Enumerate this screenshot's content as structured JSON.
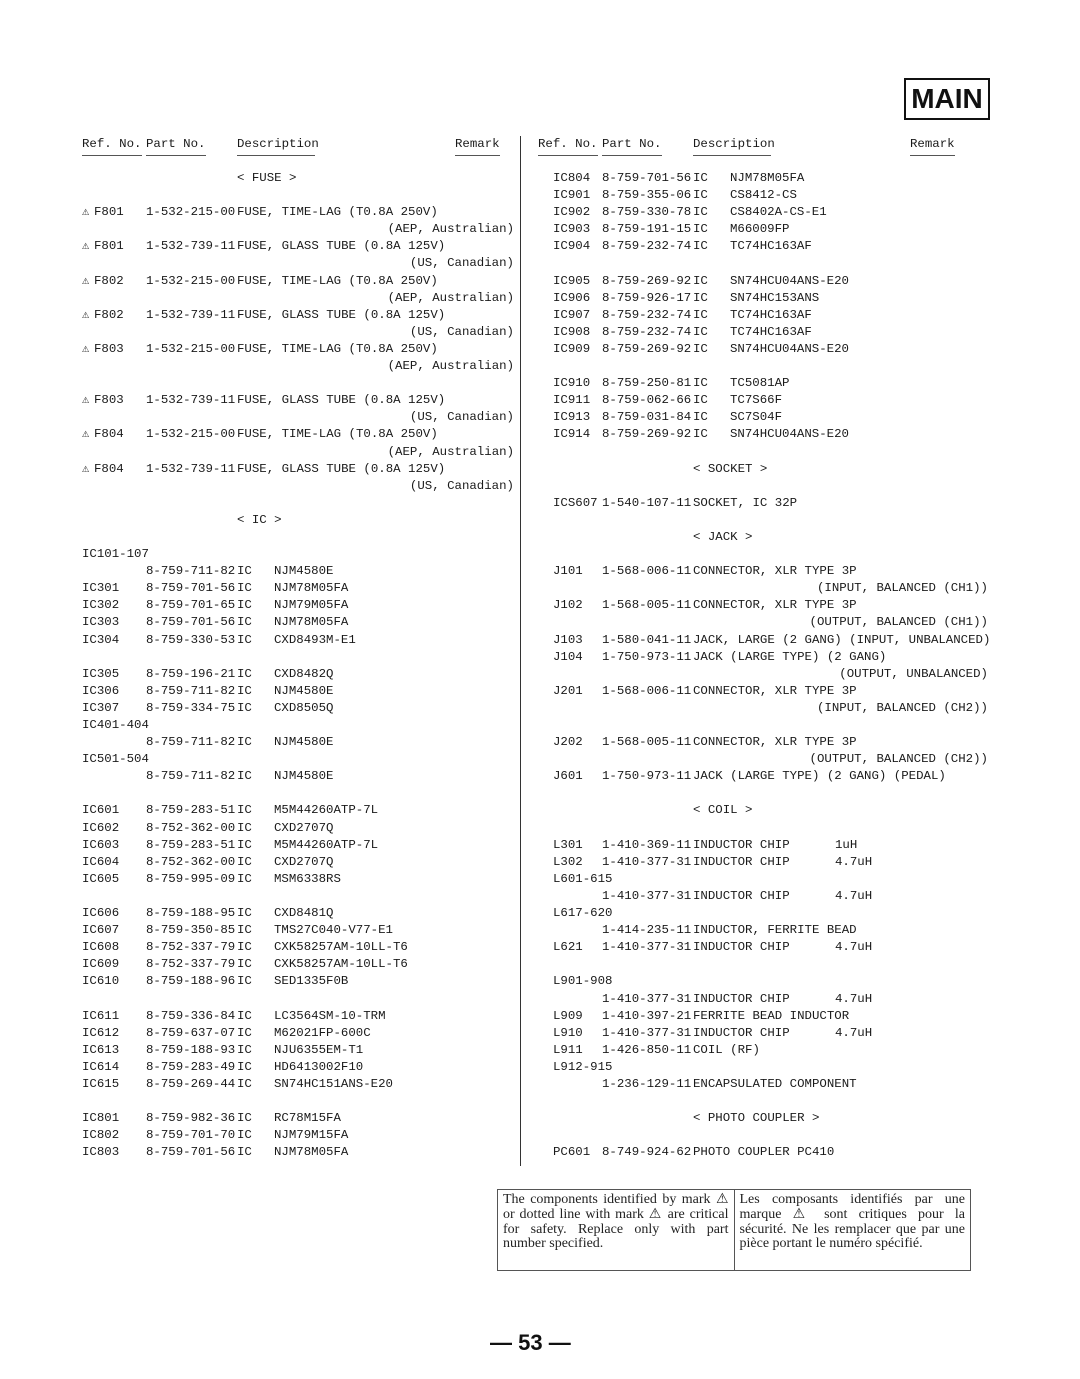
{
  "section_badge": "MAIN",
  "columns": {
    "ref": "Ref. No.",
    "part": "Part No.",
    "desc": "Description",
    "remark": "Remark"
  },
  "left": [
    {
      "type": "cat",
      "text": "< FUSE >"
    },
    {
      "type": "gap"
    },
    {
      "type": "row",
      "warn": true,
      "ref": "F801",
      "part": "1-532-215-00",
      "desc": "FUSE, TIME-LAG (T0.8A 250V)"
    },
    {
      "type": "remark",
      "text": "(AEP, Australian)"
    },
    {
      "type": "row",
      "warn": true,
      "ref": "F801",
      "part": "1-532-739-11",
      "desc": "FUSE, GLASS TUBE (0.8A 125V)"
    },
    {
      "type": "remark",
      "text": "(US, Canadian)"
    },
    {
      "type": "row",
      "warn": true,
      "ref": "F802",
      "part": "1-532-215-00",
      "desc": "FUSE, TIME-LAG (T0.8A 250V)"
    },
    {
      "type": "remark",
      "text": "(AEP, Australian)"
    },
    {
      "type": "row",
      "warn": true,
      "ref": "F802",
      "part": "1-532-739-11",
      "desc": "FUSE, GLASS TUBE (0.8A 125V)"
    },
    {
      "type": "remark",
      "text": "(US, Canadian)"
    },
    {
      "type": "row",
      "warn": true,
      "ref": "F803",
      "part": "1-532-215-00",
      "desc": "FUSE, TIME-LAG (T0.8A 250V)"
    },
    {
      "type": "remark",
      "text": "(AEP, Australian)"
    },
    {
      "type": "gap"
    },
    {
      "type": "row",
      "warn": true,
      "ref": "F803",
      "part": "1-532-739-11",
      "desc": "FUSE, GLASS TUBE (0.8A 125V)"
    },
    {
      "type": "remark",
      "text": "(US, Canadian)"
    },
    {
      "type": "row",
      "warn": true,
      "ref": "F804",
      "part": "1-532-215-00",
      "desc": "FUSE, TIME-LAG (T0.8A 250V)"
    },
    {
      "type": "remark",
      "text": "(AEP, Australian)"
    },
    {
      "type": "row",
      "warn": true,
      "ref": "F804",
      "part": "1-532-739-11",
      "desc": "FUSE, GLASS TUBE (0.8A 125V)"
    },
    {
      "type": "remark",
      "text": "(US, Canadian)"
    },
    {
      "type": "gap"
    },
    {
      "type": "cat",
      "text": "< IC >"
    },
    {
      "type": "gap"
    },
    {
      "type": "row",
      "ref": "IC101-107",
      "part": "",
      "desc": ""
    },
    {
      "type": "row",
      "ref": "",
      "part": "8-759-711-82",
      "desc": "IC",
      "model": "NJM4580E"
    },
    {
      "type": "row",
      "ref": "IC301",
      "part": "8-759-701-56",
      "desc": "IC",
      "model": "NJM78M05FA"
    },
    {
      "type": "row",
      "ref": "IC302",
      "part": "8-759-701-65",
      "desc": "IC",
      "model": "NJM79M05FA"
    },
    {
      "type": "row",
      "ref": "IC303",
      "part": "8-759-701-56",
      "desc": "IC",
      "model": "NJM78M05FA"
    },
    {
      "type": "row",
      "ref": "IC304",
      "part": "8-759-330-53",
      "desc": "IC",
      "model": "CXD8493M-E1"
    },
    {
      "type": "gap"
    },
    {
      "type": "row",
      "ref": "IC305",
      "part": "8-759-196-21",
      "desc": "IC",
      "model": "CXD8482Q"
    },
    {
      "type": "row",
      "ref": "IC306",
      "part": "8-759-711-82",
      "desc": "IC",
      "model": "NJM4580E"
    },
    {
      "type": "row",
      "ref": "IC307",
      "part": "8-759-334-75",
      "desc": "IC",
      "model": "CXD8505Q"
    },
    {
      "type": "row",
      "ref": "IC401-404",
      "part": "",
      "desc": ""
    },
    {
      "type": "row",
      "ref": "",
      "part": "8-759-711-82",
      "desc": "IC",
      "model": "NJM4580E"
    },
    {
      "type": "row",
      "ref": "IC501-504",
      "part": "",
      "desc": ""
    },
    {
      "type": "row",
      "ref": "",
      "part": "8-759-711-82",
      "desc": "IC",
      "model": "NJM4580E"
    },
    {
      "type": "gap"
    },
    {
      "type": "row",
      "ref": "IC601",
      "part": "8-759-283-51",
      "desc": "IC",
      "model": "M5M44260ATP-7L"
    },
    {
      "type": "row",
      "ref": "IC602",
      "part": "8-752-362-00",
      "desc": "IC",
      "model": "CXD2707Q"
    },
    {
      "type": "row",
      "ref": "IC603",
      "part": "8-759-283-51",
      "desc": "IC",
      "model": "M5M44260ATP-7L"
    },
    {
      "type": "row",
      "ref": "IC604",
      "part": "8-752-362-00",
      "desc": "IC",
      "model": "CXD2707Q"
    },
    {
      "type": "row",
      "ref": "IC605",
      "part": "8-759-995-09",
      "desc": "IC",
      "model": "MSM6338RS"
    },
    {
      "type": "gap"
    },
    {
      "type": "row",
      "ref": "IC606",
      "part": "8-759-188-95",
      "desc": "IC",
      "model": "CXD8481Q"
    },
    {
      "type": "row",
      "ref": "IC607",
      "part": "8-759-350-85",
      "desc": "IC",
      "model": "TMS27C040-V77-E1"
    },
    {
      "type": "row",
      "ref": "IC608",
      "part": "8-752-337-79",
      "desc": "IC",
      "model": "CXK58257AM-10LL-T6"
    },
    {
      "type": "row",
      "ref": "IC609",
      "part": "8-752-337-79",
      "desc": "IC",
      "model": "CXK58257AM-10LL-T6"
    },
    {
      "type": "row",
      "ref": "IC610",
      "part": "8-759-188-96",
      "desc": "IC",
      "model": "SED1335F0B"
    },
    {
      "type": "gap"
    },
    {
      "type": "row",
      "ref": "IC611",
      "part": "8-759-336-84",
      "desc": "IC",
      "model": "LC3564SM-10-TRM"
    },
    {
      "type": "row",
      "ref": "IC612",
      "part": "8-759-637-07",
      "desc": "IC",
      "model": "M62021FP-600C"
    },
    {
      "type": "row",
      "ref": "IC613",
      "part": "8-759-188-93",
      "desc": "IC",
      "model": "NJU6355EM-T1"
    },
    {
      "type": "row",
      "ref": "IC614",
      "part": "8-759-283-49",
      "desc": "IC",
      "model": "HD6413002F10"
    },
    {
      "type": "row",
      "ref": "IC615",
      "part": "8-759-269-44",
      "desc": "IC",
      "model": "SN74HC151ANS-E20"
    },
    {
      "type": "gap"
    },
    {
      "type": "row",
      "ref": "IC801",
      "part": "8-759-982-36",
      "desc": "IC",
      "model": "RC78M15FA"
    },
    {
      "type": "row",
      "ref": "IC802",
      "part": "8-759-701-70",
      "desc": "IC",
      "model": "NJM79M15FA"
    },
    {
      "type": "row",
      "ref": "IC803",
      "part": "8-759-701-56",
      "desc": "IC",
      "model": "NJM78M05FA"
    }
  ],
  "right": [
    {
      "type": "row",
      "ref": "IC804",
      "part": "8-759-701-56",
      "desc": "IC",
      "model": "NJM78M05FA"
    },
    {
      "type": "row",
      "ref": "IC901",
      "part": "8-759-355-06",
      "desc": "IC",
      "model": "CS8412-CS"
    },
    {
      "type": "row",
      "ref": "IC902",
      "part": "8-759-330-78",
      "desc": "IC",
      "model": "CS8402A-CS-E1"
    },
    {
      "type": "row",
      "ref": "IC903",
      "part": "8-759-191-15",
      "desc": "IC",
      "model": "M66009FP"
    },
    {
      "type": "row",
      "ref": "IC904",
      "part": "8-759-232-74",
      "desc": "IC",
      "model": "TC74HC163AF"
    },
    {
      "type": "gap"
    },
    {
      "type": "row",
      "ref": "IC905",
      "part": "8-759-269-92",
      "desc": "IC",
      "model": "SN74HCU04ANS-E20"
    },
    {
      "type": "row",
      "ref": "IC906",
      "part": "8-759-926-17",
      "desc": "IC",
      "model": "SN74HC153ANS"
    },
    {
      "type": "row",
      "ref": "IC907",
      "part": "8-759-232-74",
      "desc": "IC",
      "model": "TC74HC163AF"
    },
    {
      "type": "row",
      "ref": "IC908",
      "part": "8-759-232-74",
      "desc": "IC",
      "model": "TC74HC163AF"
    },
    {
      "type": "row",
      "ref": "IC909",
      "part": "8-759-269-92",
      "desc": "IC",
      "model": "SN74HCU04ANS-E20"
    },
    {
      "type": "gap"
    },
    {
      "type": "row",
      "ref": "IC910",
      "part": "8-759-250-81",
      "desc": "IC",
      "model": "TC5081AP"
    },
    {
      "type": "row",
      "ref": "IC911",
      "part": "8-759-062-66",
      "desc": "IC",
      "model": "TC7S66F"
    },
    {
      "type": "row",
      "ref": "IC913",
      "part": "8-759-031-84",
      "desc": "IC",
      "model": "SC7S04F"
    },
    {
      "type": "row",
      "ref": "IC914",
      "part": "8-759-269-92",
      "desc": "IC",
      "model": "SN74HCU04ANS-E20"
    },
    {
      "type": "gap"
    },
    {
      "type": "cat",
      "text": "< SOCKET >"
    },
    {
      "type": "gap"
    },
    {
      "type": "row",
      "ref": "ICS607",
      "part": "1-540-107-11",
      "desc": "SOCKET, IC 32P"
    },
    {
      "type": "gap"
    },
    {
      "type": "cat",
      "text": "< JACK >"
    },
    {
      "type": "gap"
    },
    {
      "type": "row",
      "ref": "J101",
      "part": "1-568-006-11",
      "desc": "CONNECTOR, XLR TYPE 3P"
    },
    {
      "type": "remark",
      "text": "(INPUT, BALANCED (CH1))"
    },
    {
      "type": "row",
      "ref": "J102",
      "part": "1-568-005-11",
      "desc": "CONNECTOR, XLR TYPE 3P"
    },
    {
      "type": "remark",
      "text": "(OUTPUT, BALANCED (CH1))"
    },
    {
      "type": "row",
      "ref": "J103",
      "part": "1-580-041-11",
      "desc": "JACK, LARGE (2 GANG) (INPUT, UNBALANCED)"
    },
    {
      "type": "row",
      "ref": "J104",
      "part": "1-750-973-11",
      "desc": "JACK (LARGE TYPE) (2 GANG)"
    },
    {
      "type": "remark",
      "text": "(OUTPUT, UNBALANCED)"
    },
    {
      "type": "row",
      "ref": "J201",
      "part": "1-568-006-11",
      "desc": "CONNECTOR, XLR TYPE 3P"
    },
    {
      "type": "remark",
      "text": "(INPUT, BALANCED (CH2))"
    },
    {
      "type": "gap"
    },
    {
      "type": "row",
      "ref": "J202",
      "part": "1-568-005-11",
      "desc": "CONNECTOR, XLR TYPE 3P"
    },
    {
      "type": "remark",
      "text": "(OUTPUT, BALANCED (CH2))"
    },
    {
      "type": "row",
      "ref": "J601",
      "part": "1-750-973-11",
      "desc": "JACK (LARGE TYPE) (2 GANG) (PEDAL)"
    },
    {
      "type": "gap"
    },
    {
      "type": "cat",
      "text": "< COIL >"
    },
    {
      "type": "gap"
    },
    {
      "type": "row",
      "ref": "L301",
      "part": "1-410-369-11",
      "desc": "INDUCTOR CHIP",
      "model": "1uH"
    },
    {
      "type": "row",
      "ref": "L302",
      "part": "1-410-377-31",
      "desc": "INDUCTOR CHIP",
      "model": "4.7uH"
    },
    {
      "type": "row",
      "ref": "L601-615",
      "part": "",
      "desc": ""
    },
    {
      "type": "row",
      "ref": "",
      "part": "1-410-377-31",
      "desc": "INDUCTOR CHIP",
      "model": "4.7uH"
    },
    {
      "type": "row",
      "ref": "L617-620",
      "part": "",
      "desc": ""
    },
    {
      "type": "row",
      "ref": "",
      "part": "1-414-235-11",
      "desc": "INDUCTOR, FERRITE BEAD"
    },
    {
      "type": "row",
      "ref": "L621",
      "part": "1-410-377-31",
      "desc": "INDUCTOR CHIP",
      "model": "4.7uH"
    },
    {
      "type": "gap"
    },
    {
      "type": "row",
      "ref": "L901-908",
      "part": "",
      "desc": ""
    },
    {
      "type": "row",
      "ref": "",
      "part": "1-410-377-31",
      "desc": "INDUCTOR CHIP",
      "model": "4.7uH"
    },
    {
      "type": "row",
      "ref": "L909",
      "part": "1-410-397-21",
      "desc": "FERRITE BEAD INDUCTOR"
    },
    {
      "type": "row",
      "ref": "L910",
      "part": "1-410-377-31",
      "desc": "INDUCTOR CHIP",
      "model": "4.7uH"
    },
    {
      "type": "row",
      "ref": "L911",
      "part": "1-426-850-11",
      "desc": "COIL (RF)"
    },
    {
      "type": "row",
      "ref": "L912-915",
      "part": "",
      "desc": ""
    },
    {
      "type": "row",
      "ref": "",
      "part": "1-236-129-11",
      "desc": "ENCAPSULATED COMPONENT"
    },
    {
      "type": "gap"
    },
    {
      "type": "cat",
      "text": "< PHOTO COUPLER >"
    },
    {
      "type": "gap"
    },
    {
      "type": "row",
      "ref": "PC601",
      "part": "8-749-924-62",
      "desc": "PHOTO COUPLER PC410"
    }
  ],
  "notice": {
    "en": "The components identified by mark ⚠ or dotted line with mark ⚠ are critical for safety. Replace only with part number specified.",
    "fr": "Les composants identifiés par une marque ⚠ sont critiques pour la sécurité. Ne les remplacer que par une pièce portant le numéro spécifié."
  },
  "page_number": "— 53 —",
  "warning_icon": "⚠"
}
